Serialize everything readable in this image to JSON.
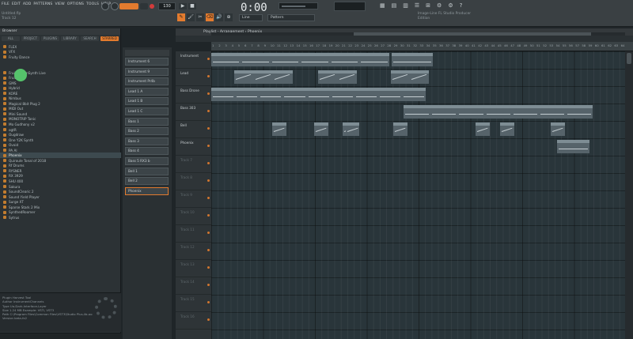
{
  "menu": [
    "FILE",
    "EDIT",
    "ADD",
    "PATTERNS",
    "VIEW",
    "OPTIONS",
    "TOOLS",
    "HELP"
  ],
  "song_info": [
    "Untitled.flp",
    "Track 12"
  ],
  "transport": {
    "pattern_label": "PAT",
    "song_label": "SONG",
    "tempo": "130",
    "time": "0:00",
    "time_sub": "00"
  },
  "tools": [
    "✎",
    "🖌",
    "✂",
    "⌫",
    "🔊",
    "⊕",
    "⊖",
    "◎"
  ],
  "toolbar_dd": [
    {
      "label": "Line",
      "w": 30
    },
    {
      "label": "Pattern",
      "w": 60
    }
  ],
  "top_right_info": [
    "Image-Line FL Studio Producer",
    "Edition"
  ],
  "browser": {
    "header": "Browser",
    "tabs": [
      "ALL",
      "PROJECT",
      "PLUGINS",
      "LIBRARY",
      "SEARCH",
      "STARRED"
    ],
    "active_tab": 5,
    "items": [
      "FLEX",
      "VFX",
      "Fruity Dance",
      "",
      "",
      "Fruity DrumSynth Live",
      "FruityWAV",
      "GMS",
      "Hybrid",
      "KORE",
      "Nimbus",
      "Magical 8bit Plug 2",
      "MIDI Out",
      "Mini Sound",
      "MONOTRIP Tonic",
      "Mo Gudhony v2",
      "ogtR",
      "Ougdraw",
      "One Y2K Synth",
      "Ovoid",
      "PA Al",
      "Phoenix",
      "Quiroule Tonal of 2018",
      "Rf Drums",
      "RYSNER",
      "RX 3929",
      "SHU 400",
      "Sakura",
      "SoundClearic 2",
      "Sound Yield Player",
      "Surge XT",
      "Sparse Stark 2 Mix",
      "SynthedRoomer",
      "Sytrus"
    ],
    "selected_index": 21,
    "info_lines": [
      "Plugin  Harvest Tool",
      "Author  InstrumentChannels",
      "Type    Ua-Dark-Interface-Layer",
      "Size    1.24 MB     Example: VSTi, VST3",
      "Path    C:\\Program Files\\Common Files\\VST3\\Studio Plus-lib-oo",
      "Version beta-fx2"
    ]
  },
  "picker": {
    "items": [
      "Instrument 6",
      "Instrument 9",
      "Instrument Pr4b",
      "Lead 1 A",
      "Lead 1 B",
      "Lead 1 C",
      "Bass 1",
      "Bass 2",
      "Bass 3",
      "Bass 4",
      "Bass 5 RX3 b",
      "Bell 1",
      "Bell 2",
      "Phoenix"
    ],
    "selected_index": 13
  },
  "playlist": {
    "title": "Playlist - Arrangement › Phoenix",
    "ruler": [
      "1",
      "2",
      "3",
      "4",
      "5",
      "6",
      "7",
      "8",
      "9",
      "10",
      "11",
      "12",
      "13",
      "14",
      "15",
      "16",
      "17",
      "18",
      "19",
      "20",
      "21",
      "22",
      "23",
      "24",
      "25",
      "26",
      "27",
      "28",
      "29",
      "30",
      "31",
      "32",
      "33",
      "34",
      "35",
      "36",
      "37",
      "38",
      "39",
      "40",
      "41",
      "42",
      "43",
      "44",
      "45",
      "46",
      "47",
      "48",
      "49",
      "50",
      "51",
      "52",
      "53",
      "54",
      "55",
      "56",
      "57",
      "58",
      "59",
      "60",
      "61",
      "62",
      "63",
      "64"
    ],
    "tracks": [
      {
        "name": "Instrument",
        "empty": false
      },
      {
        "name": "Lead",
        "empty": false
      },
      {
        "name": "Bass Drone",
        "empty": false
      },
      {
        "name": "Bass 303",
        "empty": false
      },
      {
        "name": "Bell",
        "empty": false
      },
      {
        "name": "Phoenix",
        "empty": false
      },
      {
        "name": "Track 7",
        "empty": true
      },
      {
        "name": "Track 8",
        "empty": true
      },
      {
        "name": "Track 9",
        "empty": true
      },
      {
        "name": "Track 10",
        "empty": true
      },
      {
        "name": "Track 11",
        "empty": true
      },
      {
        "name": "Track 12",
        "empty": true
      },
      {
        "name": "Track 13",
        "empty": true
      },
      {
        "name": "Track 14",
        "empty": true
      },
      {
        "name": "Track 15",
        "empty": true
      },
      {
        "name": "Track 16",
        "empty": true
      }
    ],
    "clips": [
      {
        "track": 0,
        "start": 0,
        "len": 2.3,
        "label": "Instrument 6",
        "style": "flat"
      },
      {
        "track": 0,
        "start": 2.3,
        "len": 2.3,
        "label": "Instrument 9",
        "style": "flat"
      },
      {
        "track": 0,
        "start": 4.6,
        "len": 2.3,
        "label": "Instrument 6",
        "style": "flat"
      },
      {
        "track": 0,
        "start": 6.9,
        "len": 2.3,
        "label": "Instrument 9",
        "style": "flat"
      },
      {
        "track": 0,
        "start": 9.2,
        "len": 2.3,
        "label": "Instrument 6",
        "style": "flat"
      },
      {
        "track": 0,
        "start": 11.5,
        "len": 2.3,
        "label": "Instrument 9",
        "style": "flat"
      },
      {
        "track": 0,
        "start": 14.0,
        "len": 3.2,
        "label": "Instrument Pr4b",
        "style": "flat"
      },
      {
        "track": 1,
        "start": 1.8,
        "len": 1.5,
        "label": "Lead 1",
        "style": "slope"
      },
      {
        "track": 1,
        "start": 3.3,
        "len": 1.5,
        "label": "Lead 1",
        "style": "slope"
      },
      {
        "track": 1,
        "start": 4.8,
        "len": 1.5,
        "label": "Lead 1",
        "style": "slope"
      },
      {
        "track": 1,
        "start": 8.3,
        "len": 1.5,
        "label": "Lead 1",
        "style": "slope"
      },
      {
        "track": 1,
        "start": 9.8,
        "len": 1.5,
        "label": "Lead 1",
        "style": "slope"
      },
      {
        "track": 1,
        "start": 13.9,
        "len": 1.5,
        "label": "Lead 1",
        "style": "slope"
      },
      {
        "track": 1,
        "start": 15.4,
        "len": 1.5,
        "label": "Lead 1",
        "style": "slope"
      },
      {
        "track": 2,
        "start": 0,
        "len": 1.85,
        "label": "Bass 1",
        "style": "flat"
      },
      {
        "track": 2,
        "start": 1.85,
        "len": 1.85,
        "label": "Bass 1",
        "style": "flat"
      },
      {
        "track": 2,
        "start": 3.7,
        "len": 1.85,
        "label": "Bass 1",
        "style": "flat"
      },
      {
        "track": 2,
        "start": 5.55,
        "len": 1.85,
        "label": "Bass 1",
        "style": "flat"
      },
      {
        "track": 2,
        "start": 7.4,
        "len": 1.85,
        "label": "Bass 1",
        "style": "flat"
      },
      {
        "track": 2,
        "start": 9.25,
        "len": 1.85,
        "label": "Bass 1",
        "style": "flat"
      },
      {
        "track": 2,
        "start": 11.1,
        "len": 1.85,
        "label": "Bass 1",
        "style": "flat"
      },
      {
        "track": 2,
        "start": 12.95,
        "len": 1.85,
        "label": "Bass 1",
        "style": "flat"
      },
      {
        "track": 2,
        "start": 14.8,
        "len": 1.85,
        "label": "Bass 1",
        "style": "flat"
      },
      {
        "track": 3,
        "start": 14.9,
        "len": 2.1,
        "label": "Bass 5 RX3 b",
        "style": "flat"
      },
      {
        "track": 3,
        "start": 17.0,
        "len": 2.1,
        "label": "Bass 5 RX3 b",
        "style": "flat"
      },
      {
        "track": 3,
        "start": 19.1,
        "len": 2.1,
        "label": "Bass 5 RX3 b",
        "style": "flat"
      },
      {
        "track": 3,
        "start": 21.2,
        "len": 2.1,
        "label": "Bass 5 RX3 b",
        "style": "flat"
      },
      {
        "track": 3,
        "start": 23.3,
        "len": 2.1,
        "label": "Bass 5 RX3 b",
        "style": "flat"
      },
      {
        "track": 3,
        "start": 25.4,
        "len": 2.1,
        "label": "Bass 5 RX3 b",
        "style": "flat"
      },
      {
        "track": 3,
        "start": 27.5,
        "len": 2.1,
        "label": "Bass 5 RX3 b",
        "style": "flat"
      },
      {
        "track": 4,
        "start": 4.7,
        "len": 1.1,
        "label": "Bell 1",
        "style": "slope"
      },
      {
        "track": 4,
        "start": 8.0,
        "len": 1.1,
        "label": "Bell 1",
        "style": "slope"
      },
      {
        "track": 4,
        "start": 10.2,
        "len": 1.1,
        "label": "Bell 1",
        "style": "slope"
      },
      {
        "track": 4,
        "start": 10.4,
        "len": 1.1,
        "label": "Bell 1",
        "style": "slope"
      },
      {
        "track": 4,
        "start": 14.1,
        "len": 1.1,
        "label": "Bell 1",
        "style": "slope"
      },
      {
        "track": 4,
        "start": 20.5,
        "len": 1.1,
        "label": "Bell 1",
        "style": "slope"
      },
      {
        "track": 4,
        "start": 22.4,
        "len": 1.1,
        "label": "Bell 1",
        "style": "slope"
      },
      {
        "track": 4,
        "start": 26.3,
        "len": 1.1,
        "label": "Bell 1",
        "style": "slope"
      },
      {
        "track": 5,
        "start": 26.8,
        "len": 2.5,
        "label": "Phoenix",
        "style": "flat"
      }
    ]
  }
}
